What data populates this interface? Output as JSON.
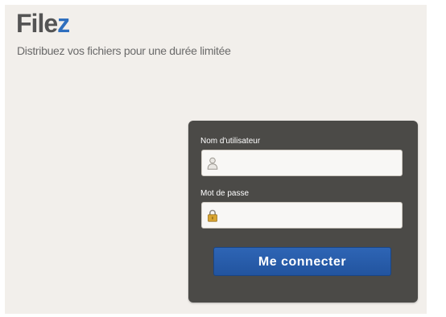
{
  "app": {
    "logo_main": "File",
    "logo_accent": "z",
    "tagline": "Distribuez vos fichiers pour une durée limitée"
  },
  "login": {
    "username_label": "Nom d'utilisateur",
    "username_value": "",
    "password_label": "Mot de passe",
    "password_value": "",
    "submit_label": "Me connecter"
  },
  "icons": {
    "username": "user-icon",
    "password": "lock-icon"
  },
  "colors": {
    "accent": "#2f6fbe",
    "button": "#2759a8",
    "panel": "#4b4a47",
    "background": "#f2efeb"
  }
}
